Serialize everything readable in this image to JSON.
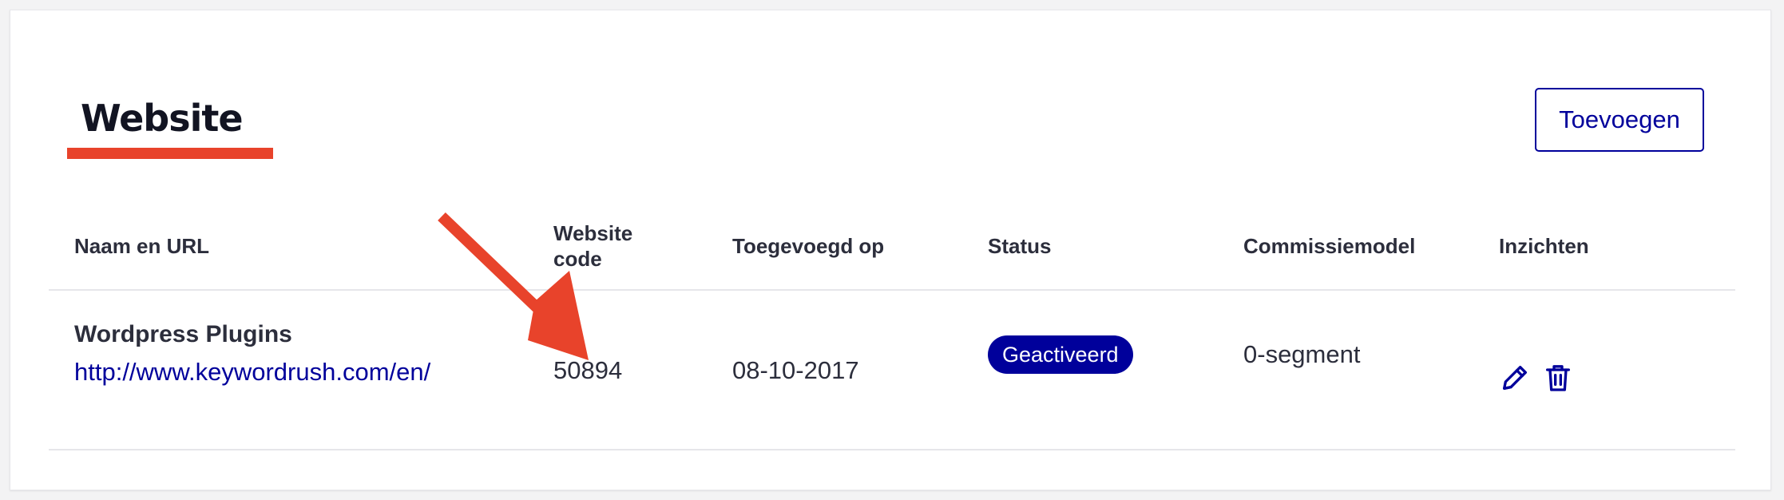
{
  "section": {
    "title": "Website",
    "add_button_label": "Toevoegen"
  },
  "table": {
    "headers": {
      "name": "Naam en URL",
      "code": "Website code",
      "added": "Toegevoegd op",
      "status": "Status",
      "commission": "Commissiemodel",
      "insights": "Inzichten"
    },
    "rows": [
      {
        "name": "Wordpress Plugins",
        "url": "http://www.keywordrush.com/en/",
        "code": "50894",
        "added": "08-10-2017",
        "status": "Geactiveerd",
        "commission": "0-segment"
      }
    ]
  },
  "colors": {
    "accent": "#e8432b",
    "brand": "#00009b",
    "text": "#2c2e3c"
  },
  "icons": {
    "edit": "pencil-icon",
    "delete": "trash-icon",
    "annotation": "red-arrow-icon"
  }
}
